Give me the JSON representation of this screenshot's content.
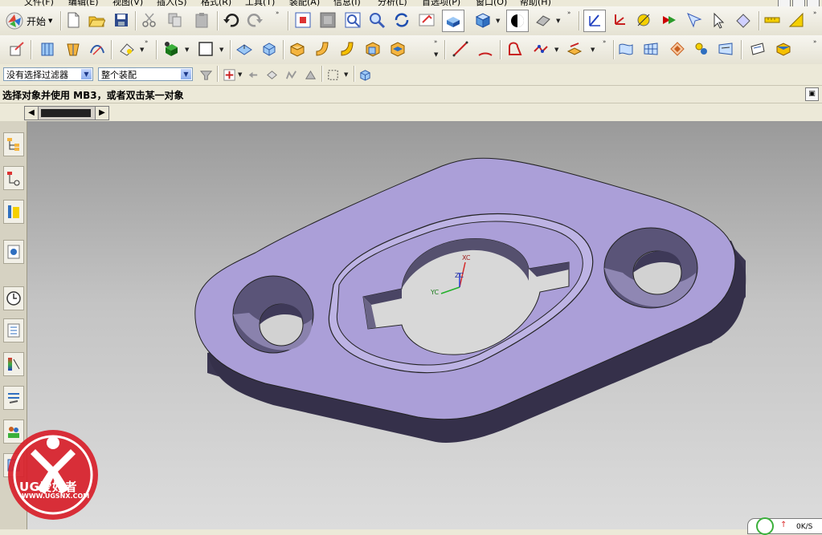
{
  "menubar": {
    "items": [
      "文件(F)",
      "编辑(E)",
      "视图(V)",
      "插入(S)",
      "格式(R)",
      "工具(T)",
      "装配(A)",
      "信息(I)",
      "分析(L)",
      "首选项(P)",
      "窗口(O)",
      "帮助(H)"
    ]
  },
  "toolbar": {
    "start_label": "开始",
    "row1_icons": [
      "new-icon",
      "open-icon",
      "save-icon",
      "cut-icon",
      "copy-icon",
      "paste-icon",
      "undo-icon",
      "redo-icon",
      "fit-icon",
      "zoom-window-icon",
      "zoom-icon",
      "pan-icon",
      "rotate-icon",
      "view-orient-icon",
      "render-style-icon",
      "shaded-icon",
      "edge-display-icon",
      "wcs-icon",
      "datum-icon",
      "datum-csys-icon",
      "snap-icon",
      "select-icon",
      "show-hide-icon",
      "measure-icon",
      "analysis-icon"
    ],
    "row2_icons": [
      "sketch-icon",
      "extrude-icon",
      "revolve-icon",
      "feature-icon",
      "hole-icon",
      "rectangle-icon",
      "surface-icon",
      "block-icon",
      "cylinder-icon",
      "cone-icon",
      "sphere-icon",
      "edge-blend-icon",
      "chamfer-icon",
      "line-icon",
      "arc-icon",
      "spline-icon",
      "curve-icon",
      "trim-icon",
      "through-curves-icon",
      "mesh-icon",
      "sweep-icon",
      "offset-icon",
      "drafting-icon",
      "shading-icon"
    ]
  },
  "selbar": {
    "filter_value": "没有选择过滤器",
    "scope_value": "整个装配"
  },
  "prompt": {
    "text": "选择对象并使用 MB3，或者双击某一对象"
  },
  "resource_bar": {
    "icons": [
      "assembly-navigator-icon",
      "part-navigator-icon",
      "reuse-library-icon",
      "web-browser-icon",
      "history-icon",
      "process-studio-icon",
      "visualization-icon",
      "roles-icon",
      "system-materials-icon",
      "palette-icon"
    ]
  },
  "viewport": {
    "wcs_labels": {
      "x": "XC",
      "y": "YC",
      "z": "ZC"
    },
    "colors": {
      "part_top": "#ab9fd8",
      "part_side": "#3b3550",
      "x_axis": "#d42a2a",
      "y_axis": "#22b02a",
      "z_axis": "#2a3ad4"
    }
  },
  "watermark": {
    "brand": "UG爱好者",
    "url": "WWW.UGSNX.COM"
  },
  "status": {
    "speed_text": "0K/S"
  }
}
